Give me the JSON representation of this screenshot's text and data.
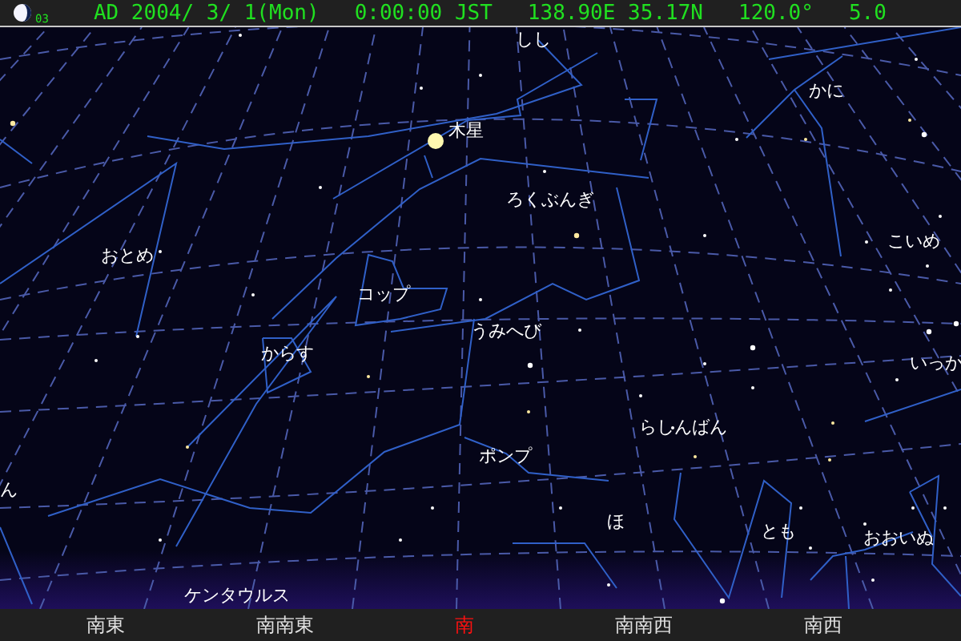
{
  "status_bar": {
    "moon_age": "03",
    "date": "AD 2004/ 3/ 1(Mon)",
    "time": "0:00:00 JST",
    "location": "138.90E 35.17N",
    "field_of_view": "120.0°",
    "magnitude_limit": "5.0"
  },
  "labels": [
    {
      "text": "しし",
      "kind": "constellation"
    },
    {
      "text": "木星",
      "kind": "planet"
    },
    {
      "text": "かに",
      "kind": "constellation"
    },
    {
      "text": "ろくぶんぎ",
      "kind": "constellation"
    },
    {
      "text": "おとめ",
      "kind": "constellation"
    },
    {
      "text": "こいめ",
      "kind": "constellation"
    },
    {
      "text": "コップ",
      "kind": "constellation"
    },
    {
      "text": "うみへび",
      "kind": "constellation"
    },
    {
      "text": "からす",
      "kind": "constellation"
    },
    {
      "text": "いっか",
      "kind": "constellation"
    },
    {
      "text": "らしんばん",
      "kind": "constellation"
    },
    {
      "text": "ポンプ",
      "kind": "constellation"
    },
    {
      "text": "ほ",
      "kind": "constellation"
    },
    {
      "text": "とも",
      "kind": "constellation"
    },
    {
      "text": "おおいぬ",
      "kind": "constellation"
    },
    {
      "text": "ケンタウルス",
      "kind": "constellation"
    },
    {
      "text": "ん",
      "kind": "constellation"
    }
  ],
  "directions": [
    {
      "label": "南東",
      "selected": false
    },
    {
      "label": "南南東",
      "selected": false
    },
    {
      "label": "南",
      "selected": true
    },
    {
      "label": "南南西",
      "selected": false
    },
    {
      "label": "南西",
      "selected": false
    }
  ]
}
